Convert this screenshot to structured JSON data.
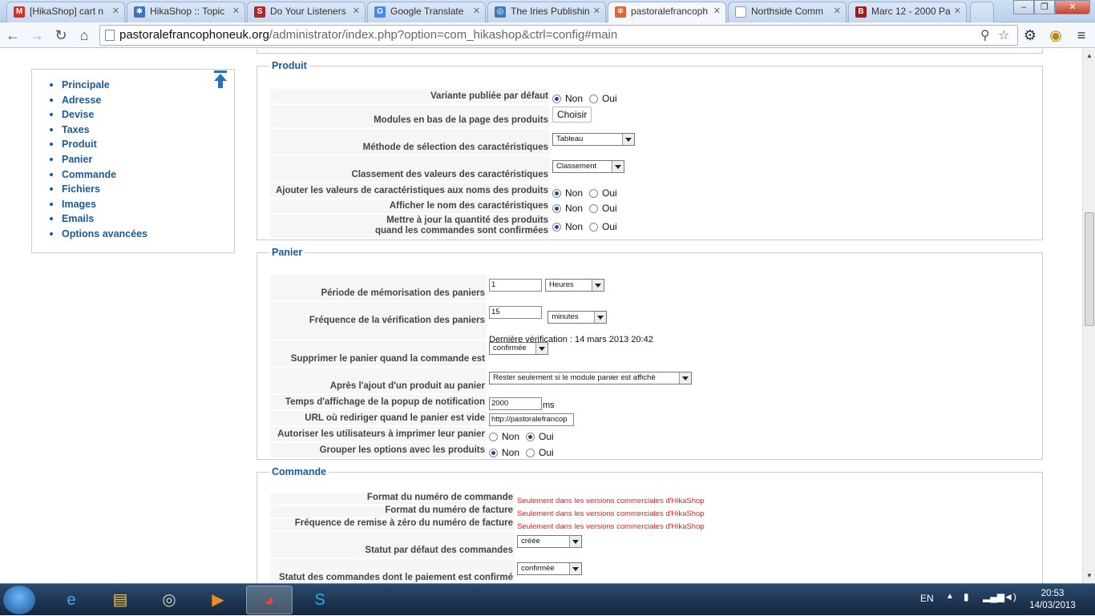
{
  "browser": {
    "tabs": [
      {
        "label": "[HikaShop] cart n",
        "icon": "gmail-icon",
        "color": "#d93025"
      },
      {
        "label": "HikaShop :: Topic",
        "icon": "hikashop-icon",
        "color": "#3a75c4"
      },
      {
        "label": "Do Your Listeners",
        "icon": "sc-icon",
        "color": "#b02727"
      },
      {
        "label": "Google Translate",
        "icon": "translate-icon",
        "color": "#4a88e8"
      },
      {
        "label": "The Iries Publishin",
        "icon": "globe-icon",
        "color": "#3d7bb8"
      },
      {
        "label": "pastoralefrancoph",
        "icon": "joomla-icon",
        "color": "#e5652e"
      },
      {
        "label": "Northside Comm",
        "icon": "page-icon",
        "color": "#999999"
      },
      {
        "label": "Marc 12 - 2000 Pa",
        "icon": "b-icon",
        "color": "#a31b1b"
      }
    ],
    "url_host": "pastoralefrancophoneuk.org",
    "url_path": "/administrator/index.php?option=com_hikashop&ctrl=config#main"
  },
  "sidebar": {
    "items": [
      "Principale",
      "Adresse",
      "Devise",
      "Taxes",
      "Produit",
      "Panier",
      "Commande",
      "Fichiers",
      "Images",
      "Emails",
      "Options avancées"
    ]
  },
  "produit": {
    "legend": "Produit",
    "variante_label": "Variante publiée par défaut",
    "modules_label": "Modules en bas de la page des produits",
    "choisir": "Choisir",
    "methode_label": "Méthode de sélection des caractéristiques",
    "methode_value": "Tableau",
    "classement_label": "Classement des valeurs des caractéristiques",
    "classement_value": "Classement",
    "ajouter_label": "Ajouter les valeurs de caractéristiques aux noms des produits",
    "afficher_label": "Afficher le nom des caractéristiques",
    "mettre_label_1": "Mettre à jour la quantité des produits",
    "mettre_label_2": "quand les commandes sont confirmées"
  },
  "radio": {
    "non": "Non",
    "oui": "Oui"
  },
  "panier": {
    "legend": "Panier",
    "periode_label": "Période de mémorisation des paniers",
    "periode_value": "1",
    "periode_unit": "Heures",
    "frequence_label": "Fréquence de la vérification des paniers",
    "frequence_value": "15",
    "frequence_unit": "minutes",
    "derniere": "Dernière vérification : 14 mars 2013 20:42",
    "supprimer_label": "Supprimer le panier quand la commande est",
    "supprimer_value": "confirmée",
    "apres_label": "Après l'ajout d'un produit au panier",
    "apres_value": "Rester seulement si le module panier est affiché",
    "temps_label": "Temps d'affichage de la popup de notification",
    "temps_value": "2000",
    "temps_unit": "ms",
    "url_label": "URL où rediriger quand le panier est vide",
    "url_value": "http://pastoralefrancop",
    "imprimer_label": "Autoriser les utilisateurs à imprimer leur panier",
    "grouper_label": "Grouper les options avec les produits"
  },
  "commande": {
    "legend": "Commande",
    "format_cmd_label": "Format du numéro de commande",
    "format_fact_label": "Format du numéro de facture",
    "freq_label": "Fréquence de remise à zéro du numéro de facture",
    "commercial_note": "Seulement dans les versions commerciales d'HikaShop",
    "statut_label": "Statut par défaut des commandes",
    "statut_value": "créée",
    "statut_paye_label": "Statut des commandes dont le paiement est confirmé",
    "statut_paye_value": "confirmée"
  },
  "taskbar": {
    "lang": "EN",
    "time": "20:53",
    "date": "14/03/2013"
  }
}
